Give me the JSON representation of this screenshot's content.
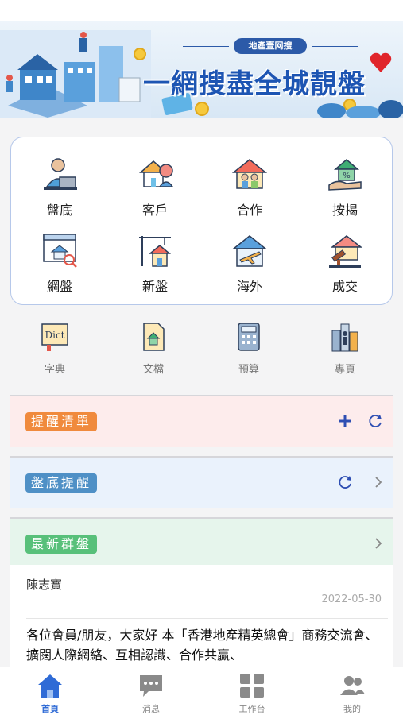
{
  "banner": {
    "tag": "地產壹网搜",
    "slogan": "一網搜盡全城靚盤"
  },
  "main_grid": [
    {
      "label": "盤底",
      "icon": "agent-at-laptop-icon"
    },
    {
      "label": "客戶",
      "icon": "house-with-people-icon"
    },
    {
      "label": "合作",
      "icon": "house-partnership-icon"
    },
    {
      "label": "按揭",
      "icon": "mortgage-percent-house-icon"
    },
    {
      "label": "網盤",
      "icon": "web-house-search-icon"
    },
    {
      "label": "新盤",
      "icon": "new-building-crane-icon"
    },
    {
      "label": "海外",
      "icon": "overseas-plane-house-icon"
    },
    {
      "label": "成交",
      "icon": "deal-gavel-house-icon"
    }
  ],
  "tools": [
    {
      "label": "字典",
      "icon": "dict-book-icon"
    },
    {
      "label": "文檔",
      "icon": "document-icon"
    },
    {
      "label": "預算",
      "icon": "calculator-icon"
    },
    {
      "label": "專頁",
      "icon": "buildings-icon"
    }
  ],
  "sections": {
    "reminder_list": "提醒清單",
    "listing_reminder": "盤底提醒",
    "latest_group_listing": "最新群盤"
  },
  "post": {
    "author": "陳志寶",
    "date": "2022-05-30",
    "body": "各位會員/朋友，大家好 本「香港地產精英總會」商務交流會、擴闊人際網絡、互相認識、合作共贏、"
  },
  "tabs": [
    {
      "label": "首頁",
      "icon": "home-icon",
      "active": true
    },
    {
      "label": "消息",
      "icon": "chat-bubble-icon",
      "active": false
    },
    {
      "label": "工作台",
      "icon": "workbench-grid-icon",
      "active": false
    },
    {
      "label": "我的",
      "icon": "profile-people-icon",
      "active": false
    }
  ],
  "colors": {
    "accent": "#2f6bd6",
    "reminder_pill": "#f08a3d",
    "listing_pill": "#4f90c6",
    "group_pill": "#58c07a"
  }
}
